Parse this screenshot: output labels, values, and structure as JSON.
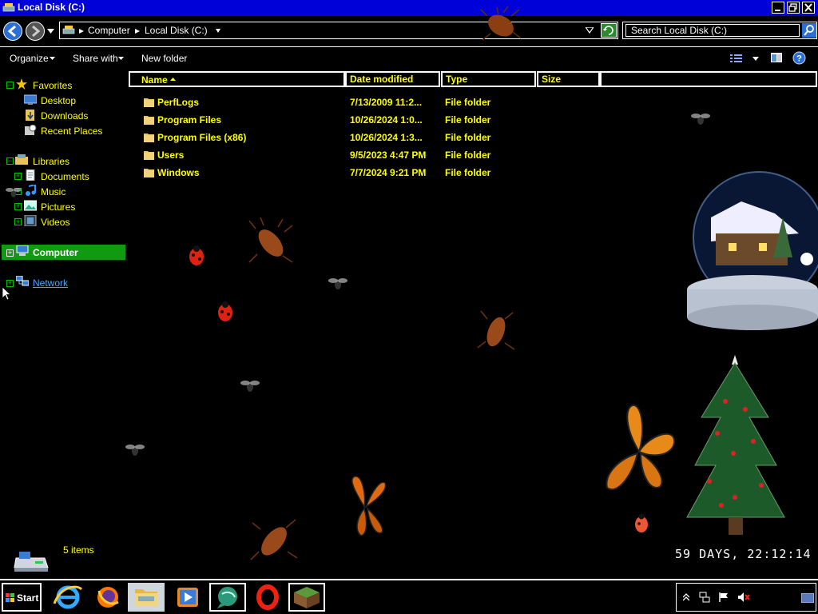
{
  "window": {
    "title": "Local Disk (C:)",
    "caption_buttons": [
      "minimize",
      "restore",
      "close"
    ]
  },
  "address": {
    "crumbs": [
      "Computer",
      "Local Disk (C:)"
    ],
    "search_placeholder": "Search Local Disk (C:)"
  },
  "toolbar": {
    "organize": "Organize",
    "share_with": "Share with",
    "new_folder": "New folder"
  },
  "nav": {
    "favorites": "Favorites",
    "desktop": "Desktop",
    "downloads": "Downloads",
    "recent_places": "Recent Places",
    "libraries": "Libraries",
    "documents": "Documents",
    "music": "Music",
    "pictures": "Pictures",
    "videos": "Videos",
    "computer": "Computer",
    "network": "Network"
  },
  "columns": {
    "name": "Name",
    "date_modified": "Date modified",
    "type": "Type",
    "size": "Size"
  },
  "files": [
    {
      "name": "PerfLogs",
      "date": "7/13/2009 11:2...",
      "type": "File folder"
    },
    {
      "name": "Program Files",
      "date": "10/26/2024 1:0...",
      "type": "File folder"
    },
    {
      "name": "Program Files (x86)",
      "date": "10/26/2024 1:3...",
      "type": "File folder"
    },
    {
      "name": "Users",
      "date": "9/5/2023 4:47 PM",
      "type": "File folder"
    },
    {
      "name": "Windows",
      "date": "7/7/2024 9:21 PM",
      "type": "File folder"
    }
  ],
  "status": {
    "item_count": "5 items"
  },
  "desktop_widget": {
    "countdown": "59 DAYS, 22:12:14"
  },
  "taskbar": {
    "start": "Start",
    "apps": [
      "internet-explorer",
      "firefox",
      "file-explorer",
      "media-player",
      "chat",
      "opera",
      "minecraft"
    ]
  },
  "colors": {
    "title_bar": "#0000d8",
    "text_highlight": "#ffff00",
    "selection": "#119911",
    "link": "#4aa3ff"
  }
}
